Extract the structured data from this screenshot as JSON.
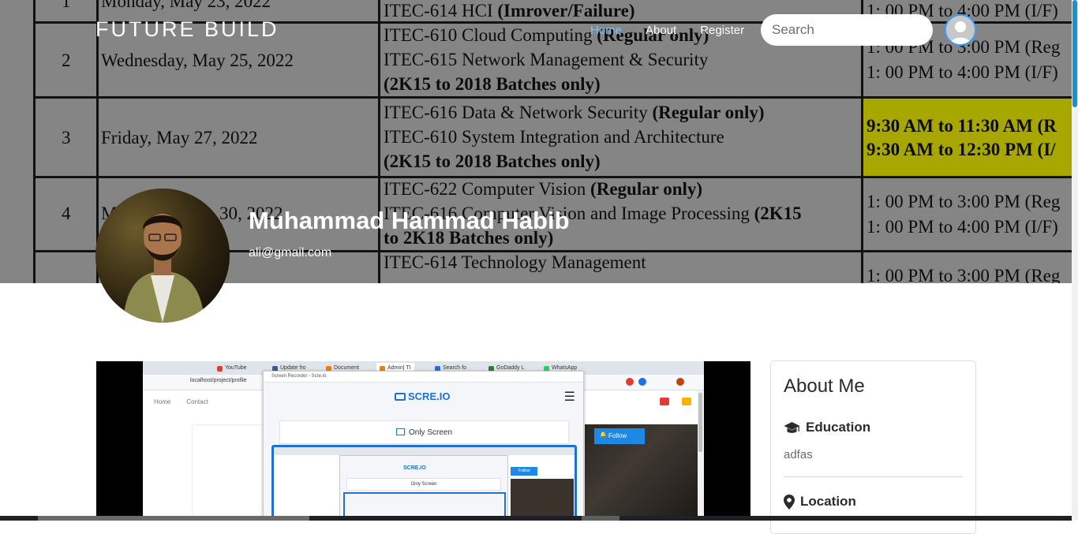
{
  "brand": "FUTURE BUILD",
  "nav": [
    {
      "label": "Home",
      "active": true
    },
    {
      "label": "About",
      "active": false
    },
    {
      "label": "Register",
      "active": false
    }
  ],
  "search": {
    "placeholder": "Search"
  },
  "profile": {
    "name": "Muhammad Hammad Habib",
    "email": "ali@gmail.com"
  },
  "cover_table": {
    "rows": [
      {
        "no": "1",
        "date": "Monday, May 23, 2022"
      },
      {
        "no": "2",
        "date": "Wednesday, May 25, 2022"
      },
      {
        "no": "3",
        "date": "Friday, May 27, 2022"
      },
      {
        "no": "4",
        "date": "M",
        "date2": "30, 2022"
      }
    ],
    "lines": [
      {
        "text": "ITEC-614  HCI",
        "bold": "(Imrover/Failure)"
      },
      {
        "text": "ITEC-610 Cloud Computing",
        "bold": "(Regular only)"
      },
      {
        "text": "ITEC-615 Network Management & Security",
        "bold": ""
      },
      {
        "text": "",
        "bold": "(2K15 to 2018 Batches only)"
      },
      {
        "text": "ITEC-616 Data & Network Security",
        "bold": "(Regular only)"
      },
      {
        "text": "ITEC-610 System Integration and Architecture",
        "bold": ""
      },
      {
        "text": "",
        "bold": "(2K15 to 2018 Batches only)"
      },
      {
        "text": "ITEC-622 Computer Vision",
        "bold": "(Regular only)"
      },
      {
        "text": "ITEC-616  Computer Vision and Image Processing",
        "bold": "(2K15"
      },
      {
        "text": "",
        "bold": "to 2K18 Batches only)"
      },
      {
        "text": "ITEC-614 Technology Management",
        "bold": ""
      }
    ],
    "times": [
      "1: 00 PM to 4:00 PM (I/F)",
      "1: 00 PM to 3:00 PM (Reg",
      "1: 00 PM to 4:00 PM (I/F)",
      "9:30 AM to 11:30 AM (R",
      "9:30 AM to 12:30 PM (I/",
      "1: 00 PM to 3:00 PM (Reg",
      "1: 00 PM to 4:00 PM (I/F)",
      "1: 00 PM to 3:00 PM (Reg"
    ]
  },
  "video": {
    "browser_tabs": [
      "YouTube",
      "Update fro",
      "Document",
      "Admin| TI",
      "Search fo",
      "GoDaddy L",
      "WhatsApp"
    ],
    "address": "localhost/project/profile",
    "site_nav": [
      "Home",
      "Contact"
    ],
    "recorder_title": "Screen Recorder - Scre.io",
    "recorder_logo": "SCRE.IO",
    "only_screen": "Only Screen",
    "follow_label": "Follow"
  },
  "about": {
    "title": "About Me",
    "education_label": "Education",
    "education_value": "adfas",
    "location_label": "Location"
  },
  "colors": {
    "accent": "#7cc3ff",
    "follow": "#1e88e5",
    "highlight": "#e8e800"
  }
}
